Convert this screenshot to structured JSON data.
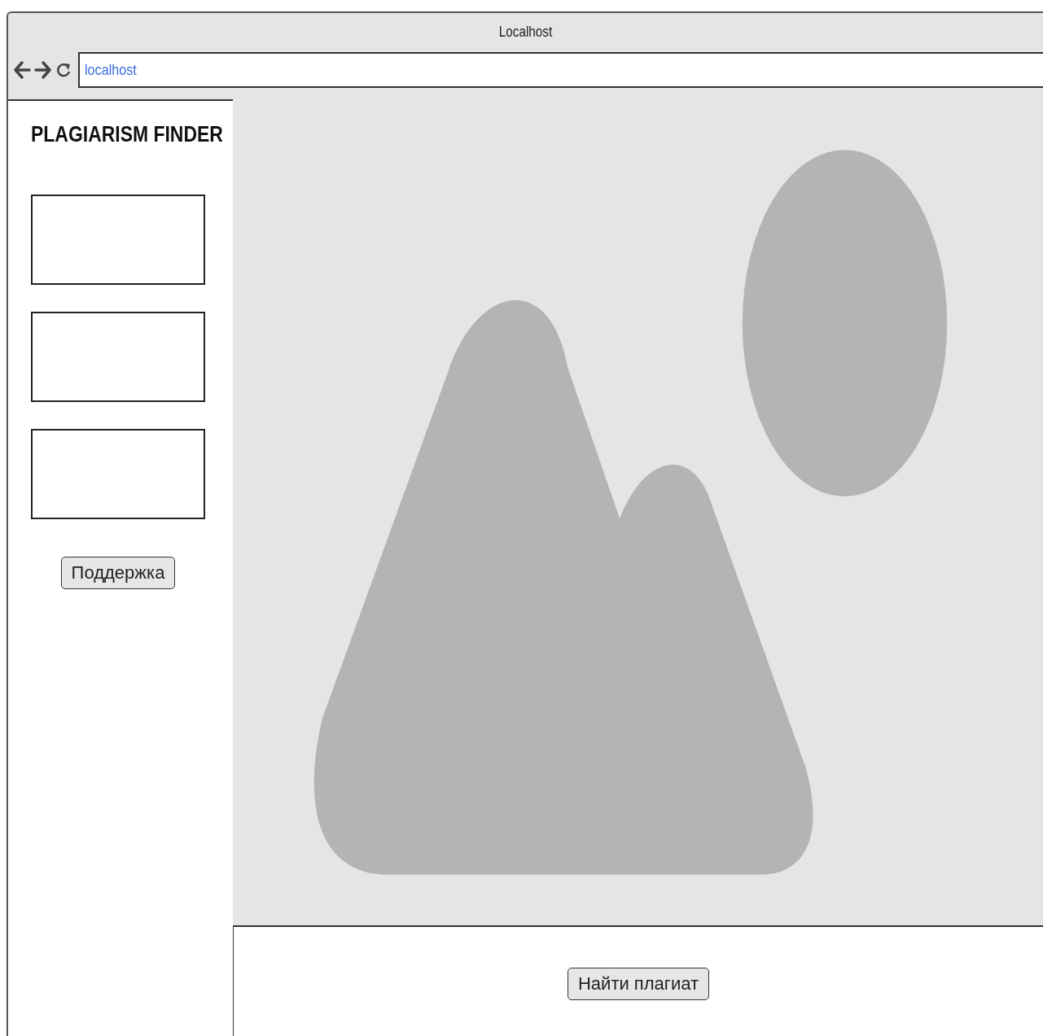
{
  "window": {
    "title": "Localhost"
  },
  "address_bar": {
    "value": "localhost"
  },
  "sidebar": {
    "title": "PLAGIARISM FINDER",
    "boxes": [
      {
        "kind": "field"
      },
      {
        "kind": "field"
      },
      {
        "kind": "field"
      }
    ],
    "button": "Поддержка"
  },
  "main": {
    "image": {
      "kind": "placeholder"
    }
  },
  "footer": {
    "button": "Найти плагиат"
  }
}
